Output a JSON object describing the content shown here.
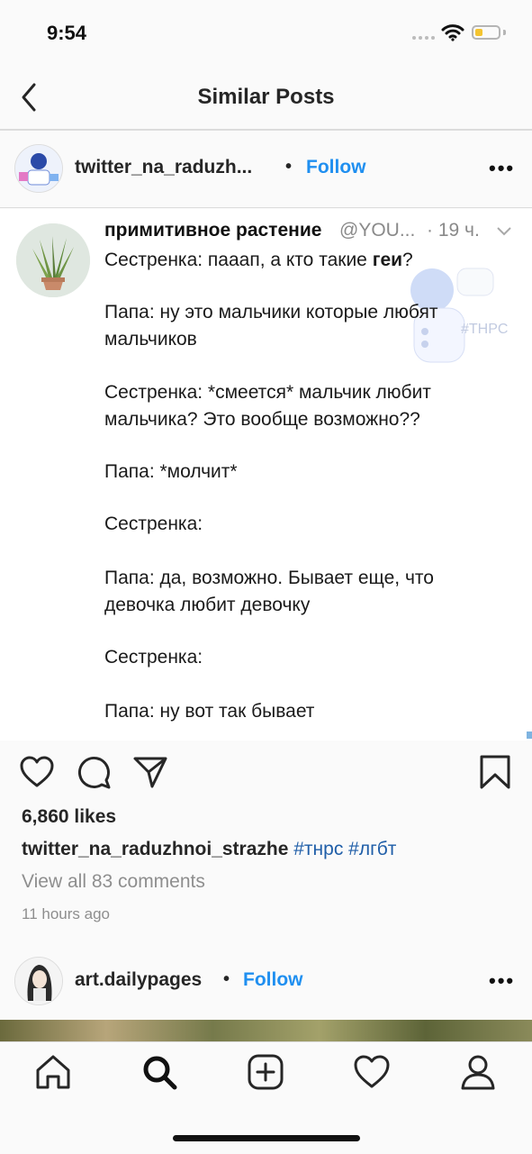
{
  "status": {
    "time": "9:54",
    "battery_color": "#f4c430",
    "battery_level": 0.3
  },
  "header": {
    "title": "Similar Posts",
    "back_icon": "chevron-left-icon"
  },
  "post1": {
    "username": "twitter_na_raduzh...",
    "dot": "•",
    "follow": "Follow",
    "more": "•••",
    "tweet": {
      "name": "примитивное растение",
      "handle": "@YOU...",
      "time": "· 19 ч.",
      "lines": [
        "Сестренка: пааап, а кто такие ",
        "геи",
        "?",
        "Папа: ну это мальчики которые любят",
        "мальчиков",
        "Сестренка: *смеется* мальчик любит",
        "мальчика? Это вообще возможно??",
        "Папа: *молчит*",
        "Сестренка:",
        "Папа: да, возможно. Бывает еще, что",
        "девочка любит девочку",
        "Сестренка:",
        "Папа: ну вот так бывает"
      ],
      "watermark": "#THPC"
    },
    "likes": "6,860 likes",
    "caption_user": "twitter_na_raduzhnoi_strazhe",
    "caption_tags": "#тнрс #лгбт",
    "comments": "View all 83 comments",
    "time_ago": "11 hours ago"
  },
  "post2": {
    "username": "art.dailypages",
    "dot": "•",
    "follow": "Follow",
    "more": "•••"
  },
  "colors": {
    "link_blue": "#1f8ff0",
    "hashtag_blue": "#1f5ea8",
    "muted": "#8e8e8e"
  },
  "tabbar": {
    "icons": [
      "home-icon",
      "search-icon",
      "add-post-icon",
      "activity-heart-icon",
      "profile-icon"
    ]
  }
}
